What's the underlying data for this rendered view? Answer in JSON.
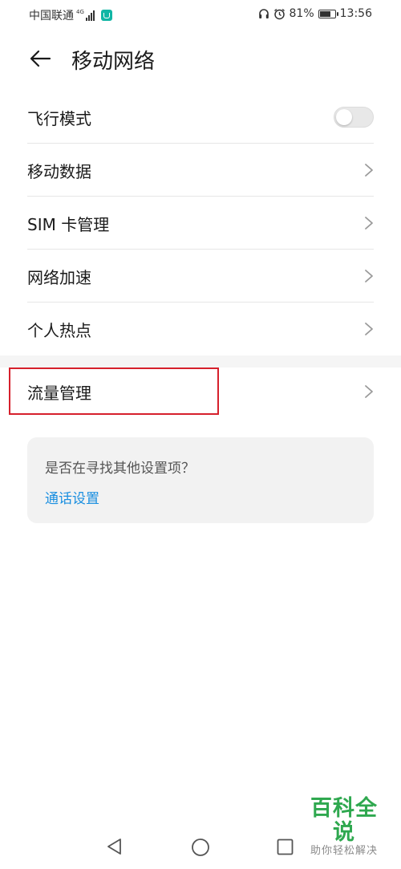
{
  "status_bar": {
    "carrier": "中国联通",
    "network_type": "4G",
    "battery": "81%",
    "battery_level": 0.81,
    "time": "13:56",
    "icons": [
      "signal-icon",
      "app-notification-icon",
      "headset-icon",
      "alarm-icon",
      "battery-icon"
    ]
  },
  "header": {
    "title": "移动网络",
    "back_icon": "arrow-left-icon"
  },
  "settings": {
    "items": [
      {
        "label": "飞行模式",
        "control": "toggle",
        "on": false
      },
      {
        "label": "移动数据",
        "control": "chevron"
      },
      {
        "label": "SIM 卡管理",
        "control": "chevron"
      },
      {
        "label": "网络加速",
        "control": "chevron"
      },
      {
        "label": "个人热点",
        "control": "chevron"
      }
    ],
    "section2": [
      {
        "label": "流量管理",
        "control": "chevron",
        "highlighted": true
      }
    ]
  },
  "suggestion": {
    "question": "是否在寻找其他设置项？",
    "link": "通话设置"
  },
  "nav_bar": {
    "icons": [
      "nav-back-icon",
      "nav-home-icon",
      "nav-recent-icon"
    ]
  },
  "watermark": {
    "main": "百科全说",
    "sub": "助你轻松解决"
  },
  "colors": {
    "accent_link": "#1a8fe0",
    "highlight_box": "#d6202c",
    "watermark_green": "#2fa84f",
    "toggle_off": "#e8e8e8"
  }
}
